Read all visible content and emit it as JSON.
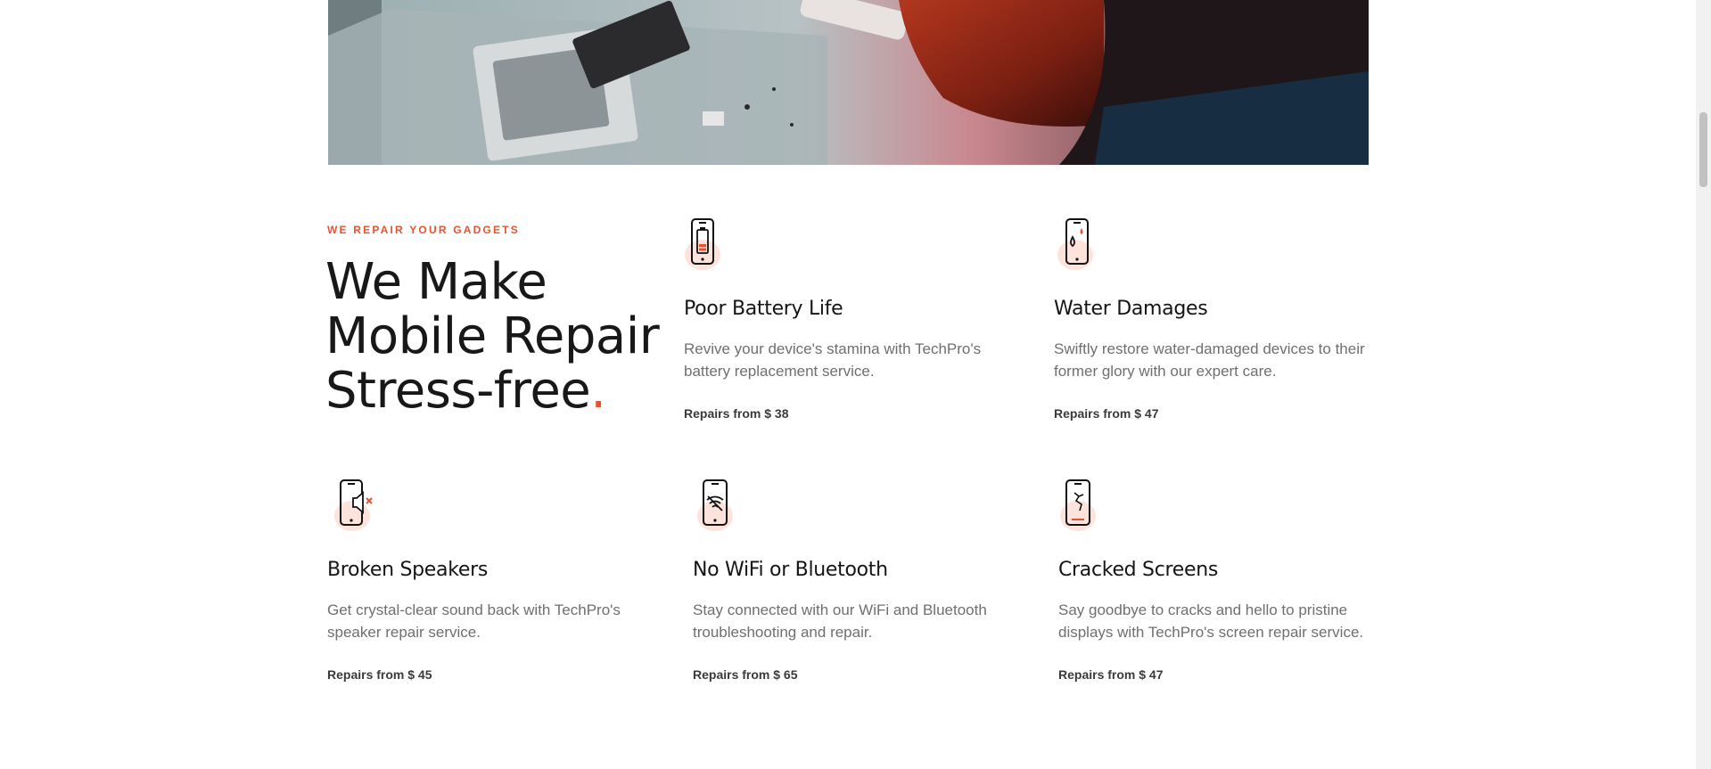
{
  "intro": {
    "eyebrow": "WE REPAIR YOUR GADGETS",
    "headline_line1": "We Make",
    "headline_line2": "Mobile Repair",
    "headline_line3": "Stress-free",
    "headline_dot": "."
  },
  "colors": {
    "accent": "#e8532f",
    "icon_blush": "#fde3dc"
  },
  "services": [
    {
      "title": "Poor Battery Life",
      "description": "Revive your device's stamina with TechPro's battery replacement service.",
      "price": "Repairs from $ 38",
      "icon": "battery-phone-icon"
    },
    {
      "title": "Water Damages",
      "description": "Swiftly restore water-damaged devices to their former glory with our expert care.",
      "price": "Repairs from $ 47",
      "icon": "water-drop-phone-icon"
    },
    {
      "title": "Broken Speakers",
      "description": "Get crystal-clear sound back with TechPro's speaker repair service.",
      "price": "Repairs from $ 45",
      "icon": "broken-speaker-phone-icon"
    },
    {
      "title": "No WiFi or Bluetooth",
      "description": "Stay connected with our WiFi and Bluetooth troubleshooting and repair.",
      "price": "Repairs from $ 65",
      "icon": "wifi-phone-icon"
    },
    {
      "title": "Cracked Screens",
      "description": "Say goodbye to cracks and hello to pristine displays with TechPro's screen repair service.",
      "price": "Repairs from $ 47",
      "icon": "cracked-screen-phone-icon"
    }
  ]
}
